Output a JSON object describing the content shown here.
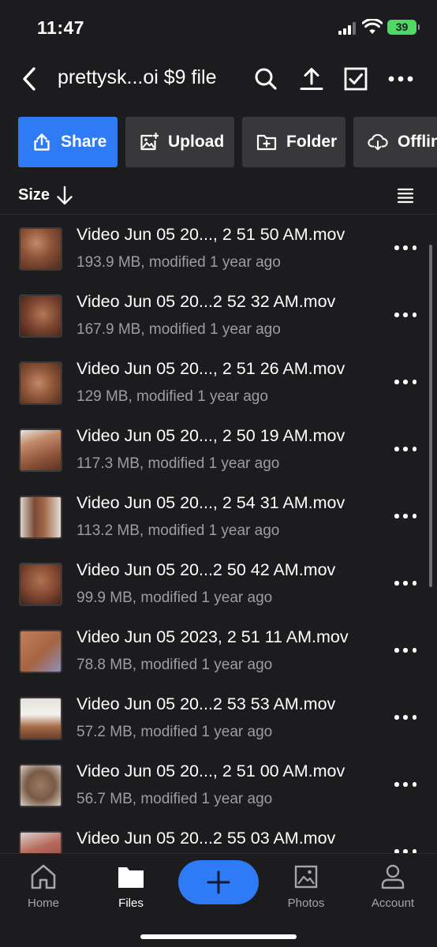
{
  "status": {
    "time": "11:47",
    "battery": "39"
  },
  "nav": {
    "title": "prettysk...oi $9 file"
  },
  "actions": [
    {
      "label": "Share",
      "icon": "share-icon"
    },
    {
      "label": "Upload",
      "icon": "upload-photo-icon"
    },
    {
      "label": "Folder",
      "icon": "new-folder-icon"
    },
    {
      "label": "Offlin",
      "icon": "cloud-download-icon"
    }
  ],
  "sort": {
    "label": "Size"
  },
  "files": [
    {
      "name": "Video Jun 05 20..., 2 51 50 AM.mov",
      "meta": "193.9 MB, modified 1 year ago"
    },
    {
      "name": "Video Jun 05 20...2 52 32 AM.mov",
      "meta": "167.9 MB, modified 1 year ago"
    },
    {
      "name": "Video Jun 05 20..., 2 51 26 AM.mov",
      "meta": "129 MB, modified 1 year ago"
    },
    {
      "name": "Video Jun 05 20..., 2 50 19 AM.mov",
      "meta": "117.3 MB, modified 1 year ago"
    },
    {
      "name": "Video Jun 05 20..., 2 54 31 AM.mov",
      "meta": "113.2 MB, modified 1 year ago"
    },
    {
      "name": "Video Jun 05 20...2 50 42 AM.mov",
      "meta": "99.9 MB, modified 1 year ago"
    },
    {
      "name": "Video Jun 05 2023, 2 51 11 AM.mov",
      "meta": "78.8 MB, modified 1 year ago"
    },
    {
      "name": "Video Jun 05 20...2 53 53 AM.mov",
      "meta": "57.2 MB, modified 1 year ago"
    },
    {
      "name": "Video Jun 05 20..., 2 51 00 AM.mov",
      "meta": "56.7 MB, modified 1 year ago"
    },
    {
      "name": "Video Jun 05 20...2 55 03 AM.mov",
      "meta": ""
    }
  ],
  "tabs": [
    {
      "label": "Home",
      "icon": "home-icon"
    },
    {
      "label": "Files",
      "icon": "folder-icon",
      "active": true
    },
    {
      "label": "Photos",
      "icon": "photo-icon"
    },
    {
      "label": "Account",
      "icon": "person-icon"
    }
  ],
  "colors": {
    "background": "#1c1c1e",
    "accent": "#2f7af5",
    "pill": "#38383a",
    "secondary_text": "#9d9da2",
    "battery": "#4cd964"
  }
}
